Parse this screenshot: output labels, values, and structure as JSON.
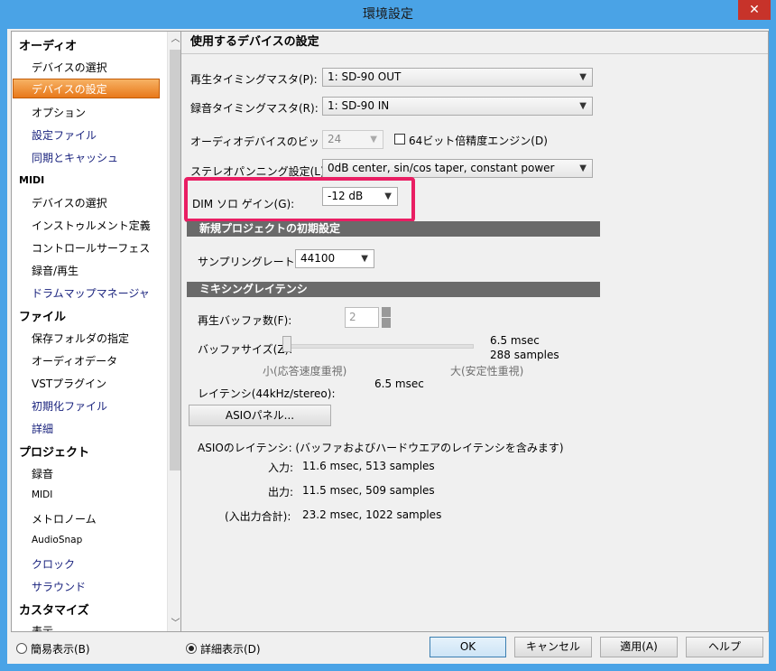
{
  "window": {
    "title": "環境設定",
    "close_glyph": "✕"
  },
  "sidebar": {
    "groups": [
      {
        "label": "オーディオ",
        "items": [
          "デバイスの選択",
          "デバイスの設定",
          "オプション",
          "設定ファイル",
          "同期とキャッシュ"
        ]
      },
      {
        "label": "MIDI",
        "items": [
          "デバイスの選択",
          "インストゥルメント定義",
          "コントロールサーフェス",
          "録音/再生",
          "ドラムマップマネージャ"
        ]
      },
      {
        "label": "ファイル",
        "items": [
          "保存フォルダの指定",
          "オーディオデータ",
          "VSTプラグイン",
          "初期化ファイル",
          "詳細"
        ]
      },
      {
        "label": "プロジェクト",
        "items": [
          "録音",
          "MIDI",
          "メトロノーム",
          "AudioSnap",
          "クロック",
          "サラウンド"
        ]
      },
      {
        "label": "カスタマイズ",
        "items": [
          "表示"
        ]
      }
    ],
    "selected": "デバイスの設定",
    "scroll_up": "︿",
    "scroll_down": "﹀"
  },
  "main": {
    "section_title": "使用するデバイスの設定",
    "playback_master": {
      "label": "再生タイミングマスタ(P):",
      "value": "1: SD-90 OUT"
    },
    "record_master": {
      "label": "録音タイミングマスタ(R):",
      "value": "1: SD-90 IN"
    },
    "bit_depth": {
      "label": "オーディオデバイスのビット数(T)",
      "value": "24"
    },
    "engine64": {
      "label": "64ビット倍精度エンジン(D)"
    },
    "stereo_pan": {
      "label": "ステレオパンニング設定(L):",
      "value": "0dB center, sin/cos taper, constant power"
    },
    "dim_solo": {
      "label": "DIM ソロ ゲイン(G):",
      "value": "-12 dB"
    },
    "new_project": {
      "header": "新規プロジェクトの初期設定",
      "sample_rate_label": "サンプリングレート(S):",
      "sample_rate_value": "44100"
    },
    "mixing_latency": {
      "header": "ミキシングレイテンシ",
      "buffers_label": "再生バッファ数(F):",
      "buffers_value": "2",
      "buffer_size_label": "バッファサイズ(Z):",
      "buffer_msec": "6.5 msec",
      "buffer_samples": "288 samples",
      "small_label": "小(応答速度重視)",
      "large_label": "大(安定性重視)",
      "latency_label": "レイテンシ(44kHz/stereo):",
      "latency_value": "6.5 msec",
      "asio_button": "ASIOパネル..."
    },
    "asio_latency": {
      "title": "ASIOのレイテンシ: (バッファおよびハードウエアのレイテンシを含みます)",
      "input_label": "入力:",
      "input_value": "11.6 msec, 513 samples",
      "output_label": "出力:",
      "output_value": "11.5 msec, 509 samples",
      "total_label": "(入出力合計):",
      "total_value": "23.2 msec, 1022 samples"
    }
  },
  "footer": {
    "simple_view": "簡易表示(B)",
    "detail_view": "詳細表示(D)",
    "ok": "OK",
    "cancel": "キャンセル",
    "apply": "適用(A)",
    "help": "ヘルプ"
  },
  "colors": {
    "titlebar": "#4aa3e6",
    "selected_item": "#e8781a",
    "highlight": "#e91e63",
    "close": "#c7332a"
  }
}
